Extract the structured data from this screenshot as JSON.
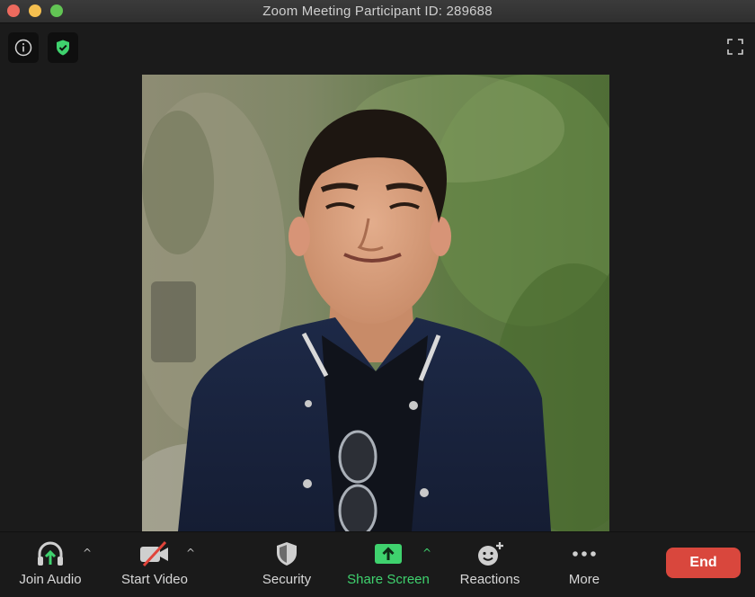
{
  "window": {
    "title": "Zoom Meeting Participant ID: 289688"
  },
  "toolbar": {
    "join_audio": "Join Audio",
    "start_video": "Start Video",
    "security": "Security",
    "share_screen": "Share Screen",
    "reactions": "Reactions",
    "more": "More",
    "end": "End"
  },
  "colors": {
    "end_button": "#d9473d",
    "share_screen_accent": "#3fd26e",
    "window_background": "#1b1b1b"
  },
  "icons": {
    "info": "info-icon",
    "encryption": "shield-check-icon",
    "fullscreen": "fullscreen-icon",
    "audio": "headphones-icon",
    "video": "video-off-icon",
    "security": "shield-icon",
    "share": "share-screen-icon",
    "reactions": "emoji-plus-icon",
    "more": "more-dots-icon"
  }
}
